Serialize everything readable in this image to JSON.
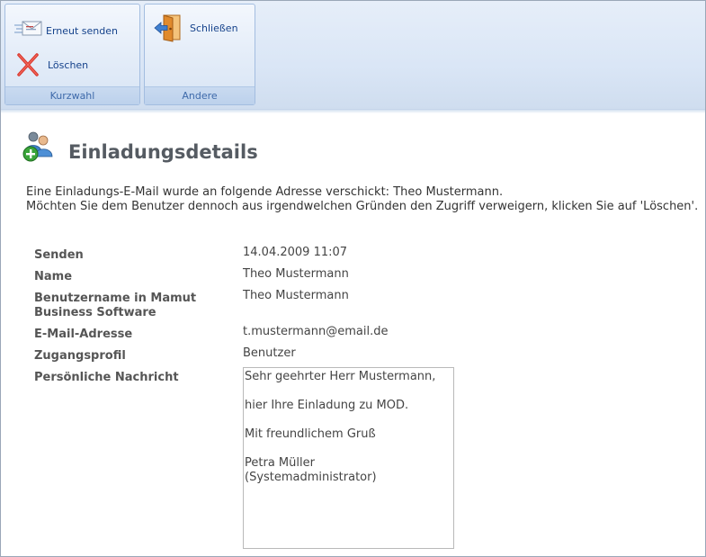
{
  "ribbon": {
    "groups": [
      {
        "label": "Kurzwahl"
      },
      {
        "label": "Andere"
      }
    ],
    "resend_label": "Erneut senden",
    "delete_label": "Löschen",
    "close_label": "Schließen"
  },
  "page": {
    "title": "Einladungsdetails",
    "intro_line1": "Eine Einladungs-E-Mail wurde an folgende Adresse verschickt: Theo Mustermann.",
    "intro_line2": "Möchten Sie dem Benutzer dennoch aus irgendwelchen Gründen den Zugriff verweigern, klicken Sie auf 'Löschen'."
  },
  "details": {
    "sent_label": "Senden",
    "sent_value": "14.04.2009 11:07",
    "name_label": "Name",
    "name_value": "Theo Mustermann",
    "username_label_line1": "Benutzername in Mamut",
    "username_label_line2": "Business Software",
    "username_value": "Theo Mustermann",
    "email_label": "E-Mail-Adresse",
    "email_value": "t.mustermann@email.de",
    "profile_label": "Zugangsprofil",
    "profile_value": "Benutzer",
    "message_label": "Persönliche Nachricht",
    "message_lines": [
      "Sehr geehrter Herr Mustermann,",
      "hier Ihre Einladung zu MOD.",
      "Mit freundlichem Gruß",
      "Petra Müller\n(Systemadministrator)"
    ]
  },
  "colors": {
    "ribbon_text": "#15428b",
    "group_label_text": "#3e6aaa",
    "title_text": "#555b62"
  }
}
